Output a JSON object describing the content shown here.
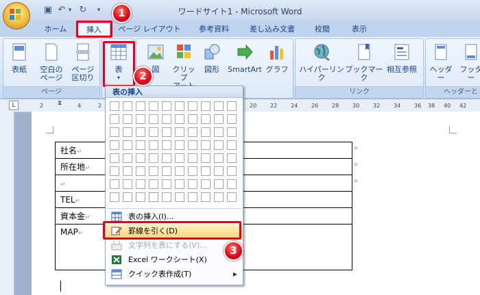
{
  "window": {
    "title": "ワードサイト1 - Microsoft Word"
  },
  "tabs": [
    "ホーム",
    "挿入",
    "ページ レイアウト",
    "参考資料",
    "差し込み文書",
    "校閲",
    "表示"
  ],
  "ribbon": {
    "groups": {
      "pages": {
        "label": "ページ",
        "buttons": [
          {
            "l1": "表紙",
            "l2": ""
          },
          {
            "l1": "空白の",
            "l2": "ページ"
          },
          {
            "l1": "ページ",
            "l2": "区切り"
          }
        ]
      },
      "table": {
        "label": "表"
      },
      "illus": {
        "buttons": [
          {
            "l1": "図",
            "l2": ""
          },
          {
            "l1": "クリップ",
            "l2": "アート"
          },
          {
            "l1": "図形",
            "l2": ""
          },
          {
            "l1": "SmartArt",
            "l2": ""
          },
          {
            "l1": "グラフ",
            "l2": ""
          }
        ]
      },
      "links": {
        "label": "リンク",
        "buttons": [
          {
            "l1": "ハイパーリンク",
            "l2": ""
          },
          {
            "l1": "ブックマーク",
            "l2": ""
          },
          {
            "l1": "相互参照",
            "l2": ""
          }
        ]
      },
      "header": {
        "label": "ヘッダーとフ",
        "buttons": [
          {
            "l1": "ヘッダー",
            "l2": ""
          },
          {
            "l1": "フッター",
            "l2": ""
          }
        ]
      }
    }
  },
  "ruler": {
    "ticks": [
      "2",
      "",
      "2",
      "4",
      "20",
      "22",
      "24",
      "26",
      "28",
      "30",
      "32",
      "34",
      "36",
      "38",
      "40",
      "42"
    ]
  },
  "document": {
    "rows": [
      "社名",
      "所在地",
      "",
      "TEL",
      "資本金",
      "MAP"
    ],
    "para_mark": "↵"
  },
  "dropdown": {
    "header": "表の挿入",
    "items": [
      {
        "label": "表の挿入(I)...",
        "disabled": false
      },
      {
        "label": "罫線を引く(D)",
        "disabled": false
      },
      {
        "label": "文字列を表にする(V)...",
        "disabled": true
      },
      {
        "label": "Excel ワークシート(X)",
        "disabled": false
      },
      {
        "label": "クイック表作成(T)",
        "disabled": false
      }
    ]
  },
  "callouts": [
    "1",
    "2",
    "3"
  ],
  "colors": {
    "red": "#e0001b",
    "ribbon": "#dbe7f7",
    "highlight": "#fcd67a"
  }
}
